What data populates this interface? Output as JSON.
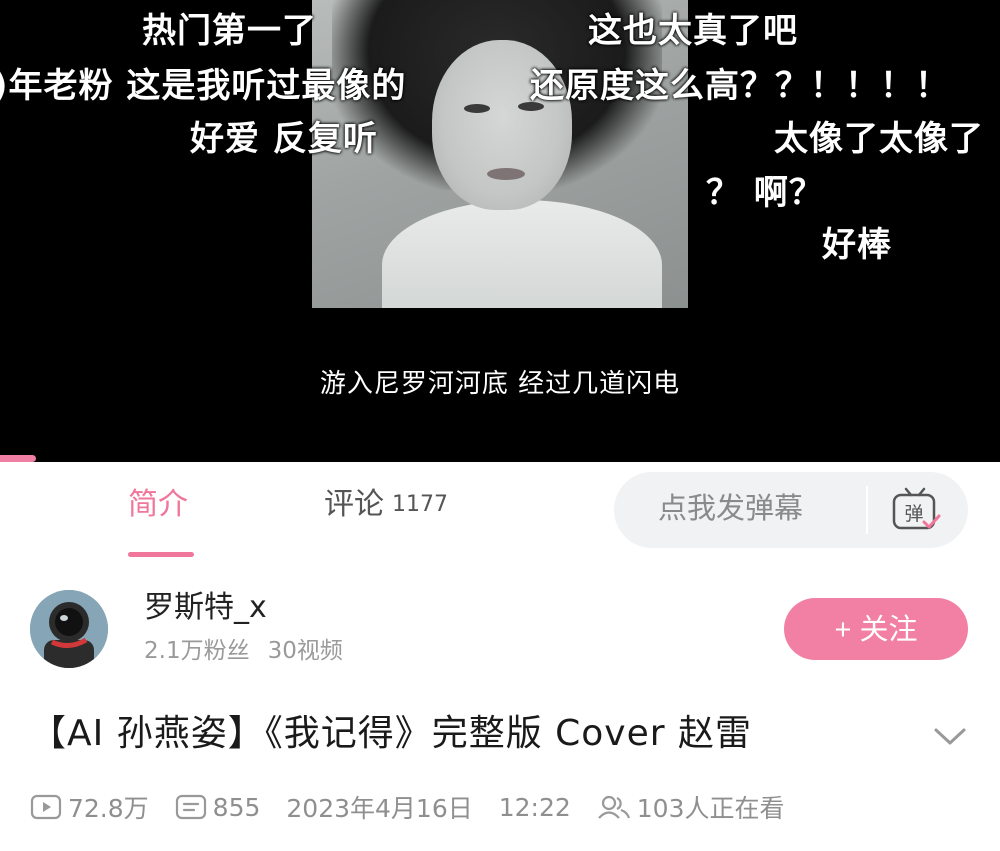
{
  "player": {
    "danmaku": [
      {
        "id": "d1",
        "text": "热门第一了"
      },
      {
        "id": "d2",
        "text": "这也太真了吧"
      },
      {
        "id": "d3",
        "text": ")年老粉 这是我听过最像的"
      },
      {
        "id": "d4",
        "text": "还原度这么高？？！！！！"
      },
      {
        "id": "d5",
        "text": "好爱 反复听"
      },
      {
        "id": "d6",
        "text": "太像了太像了"
      },
      {
        "id": "d7",
        "text": "？ 啊？"
      },
      {
        "id": "d8",
        "text": "好棒"
      }
    ],
    "subtitle": "游入尼罗河河底 经过几道闪电",
    "accent_color": "#f17ea3"
  },
  "tabs": {
    "intro_label": "简介",
    "comments_label": "评论",
    "comments_count": "1177",
    "active_color": "#f0769b"
  },
  "danmaku_input": {
    "placeholder": "点我发弹幕",
    "toggle_icon": "danmaku-toggle-icon",
    "toggle_glyph": "弹"
  },
  "uploader": {
    "name": "罗斯特_x",
    "fans": "2.1万粉丝",
    "videos": "30视频",
    "follow_label": "+ 关注",
    "follow_color": "#f27fa4",
    "avatar_icon": "astronaut-avatar"
  },
  "video": {
    "title": "【AI  孙燕姿】《我记得》完整版  Cover  赵雷",
    "views": "72.8万",
    "danmaku_count": "855",
    "date": "2023年4月16日",
    "time": "12:22",
    "watching": "103人正在看"
  }
}
